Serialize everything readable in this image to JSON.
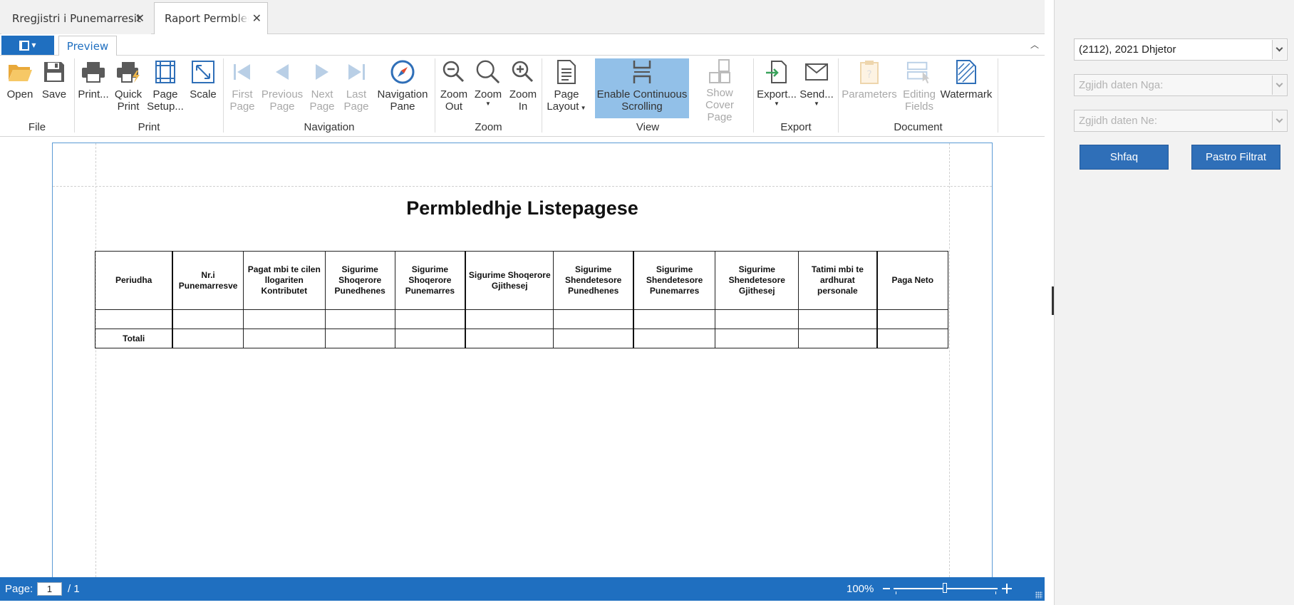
{
  "tabs": [
    {
      "label": "Rregjistri i Punemarresit",
      "close": "✕"
    },
    {
      "label": "Raport Permbledhje",
      "close": "✕"
    }
  ],
  "ribbon": {
    "page_tab": "Preview",
    "buttons": {
      "open": {
        "l1": "Open",
        "l2": ""
      },
      "save": {
        "l1": "Save",
        "l2": ""
      },
      "print": {
        "l1": "Print...",
        "l2": ""
      },
      "quick_print": {
        "l1": "Quick",
        "l2": "Print"
      },
      "page_setup": {
        "l1": "Page",
        "l2": "Setup..."
      },
      "scale": {
        "l1": "Scale",
        "l2": ""
      },
      "first_page": {
        "l1": "First",
        "l2": "Page"
      },
      "previous_page": {
        "l1": "Previous",
        "l2": "Page"
      },
      "next_page": {
        "l1": "Next",
        "l2": "Page"
      },
      "last_page": {
        "l1": "Last",
        "l2": "Page"
      },
      "navigation_pane": {
        "l1": "Navigation",
        "l2": "Pane"
      },
      "zoom_out": {
        "l1": "Zoom",
        "l2": "Out"
      },
      "zoom": {
        "l1": "Zoom",
        "l2": ""
      },
      "zoom_in": {
        "l1": "Zoom",
        "l2": "In"
      },
      "page_layout": {
        "l1": "Page",
        "l2": "Layout"
      },
      "continuous_scrolling": {
        "l1": "Enable Continuous",
        "l2": "Scrolling"
      },
      "show_cover_page": {
        "l1": "Show Cover",
        "l2": "Page"
      },
      "export": {
        "l1": "Export...",
        "l2": ""
      },
      "send": {
        "l1": "Send...",
        "l2": ""
      },
      "parameters": {
        "l1": "Parameters",
        "l2": ""
      },
      "editing_fields": {
        "l1": "Editing",
        "l2": "Fields"
      },
      "watermark": {
        "l1": "Watermark",
        "l2": ""
      }
    },
    "groups": {
      "file": "File",
      "print": "Print",
      "navigation": "Navigation",
      "zoom": "Zoom",
      "view": "View",
      "export": "Export",
      "document": "Document"
    }
  },
  "report": {
    "title": "Permbledhje Listepagese",
    "columns": [
      "Periudha",
      "Nr.i Punemarresve",
      "Pagat mbi te cilen llogariten Kontributet",
      "Sigurime Shoqerore Punedhenes",
      "Sigurime Shoqerore Punemarres",
      "Sigurime Shoqerore Gjithesej",
      "Sigurime Shendetesore Punedhenes",
      "Sigurime Shendetesore Punemarres",
      "Sigurime Shendetesore Gjithesej",
      "Tatimi mbi te ardhurat personale",
      "Paga Neto"
    ],
    "total_label": "Totali"
  },
  "statusbar": {
    "page_label": "Page:",
    "page_value": "1",
    "page_total": "/ 1",
    "zoom": "100%"
  },
  "filters": {
    "period": "(2112), 2021 Dhjetor",
    "date_from_placeholder": "Zgjidh daten Nga:",
    "date_to_placeholder": "Zgjidh daten Ne:",
    "show_button": "Shfaq",
    "clear_button": "Pastro Filtrat"
  },
  "colors": {
    "accent": "#1f6fc0",
    "active_toggle": "#92c0e8",
    "open_icon": "#f0b84a",
    "panel_background": "#f2f2f2"
  },
  "icons": {
    "open": "folder-open-icon",
    "save": "floppy-disk-icon",
    "print": "printer-icon",
    "navigation_pane": "compass-icon",
    "zoom": "magnifier-icon",
    "send": "envelope-icon"
  }
}
